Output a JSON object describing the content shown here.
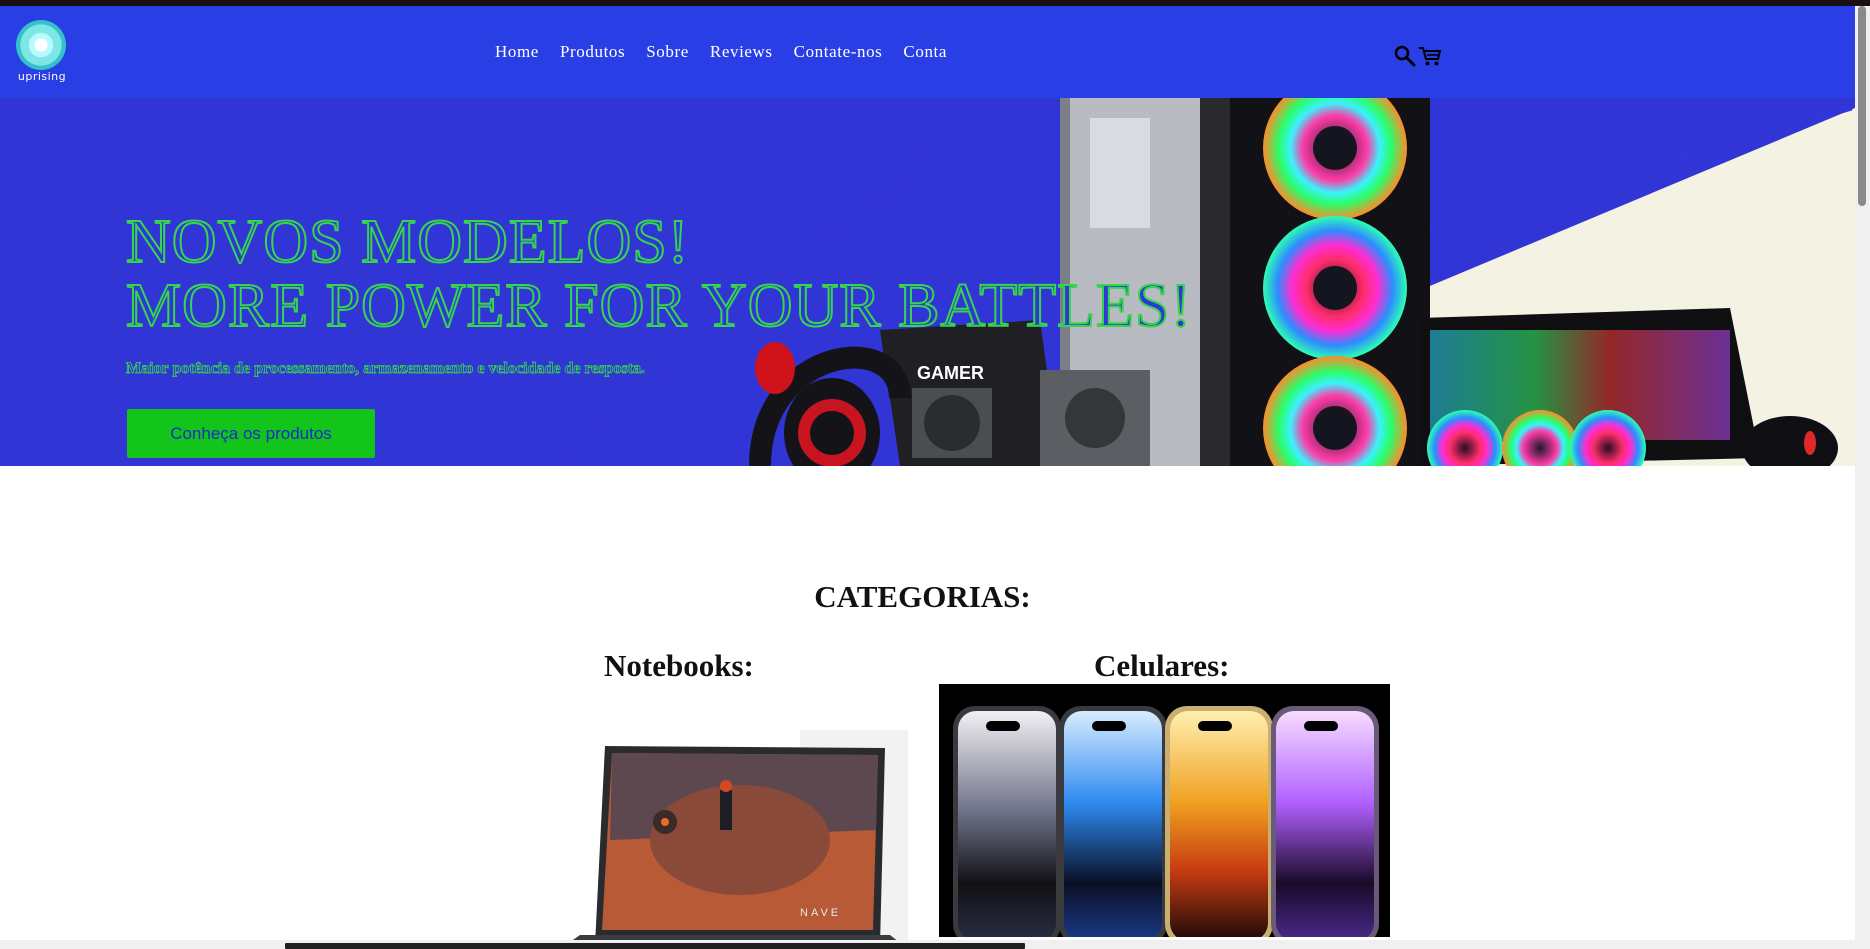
{
  "brand": {
    "name": "uprising"
  },
  "nav": {
    "links": [
      {
        "label": "Home"
      },
      {
        "label": "Produtos"
      },
      {
        "label": "Sobre"
      },
      {
        "label": "Reviews"
      },
      {
        "label": "Contate-nos"
      },
      {
        "label": "Conta"
      }
    ],
    "search_icon": "search-icon",
    "cart_icon": "cart-icon"
  },
  "hero": {
    "title_line1": "NOVOS MODELOS!",
    "title_line2": "MORE POWER FOR YOUR BATTLES!",
    "subtitle": "Maior potência de processamento, armazenamento e velocidade de resposta.",
    "cta_label": "Conheça os produtos",
    "image_text": "GAMER"
  },
  "categories": {
    "title": "CATEGORIAS:",
    "items": [
      {
        "label": "Notebooks:",
        "image_text": "NAVE"
      },
      {
        "label": "Celulares:"
      }
    ]
  },
  "colors": {
    "header_bg": "#2a3ee6",
    "hero_bg": "#3235d6",
    "accent_green": "#35d64a",
    "cta_bg": "#13c41a"
  }
}
